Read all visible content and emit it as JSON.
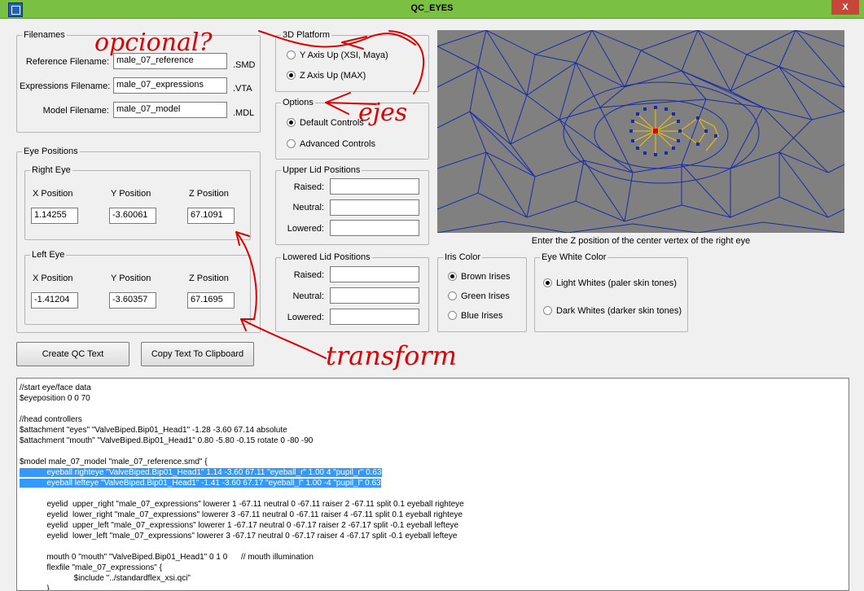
{
  "window": {
    "title": "QC_EYES",
    "close_label": "X"
  },
  "filenames": {
    "group_label": "Filenames",
    "reference": {
      "label": "Reference Filename:",
      "value": "male_07_reference",
      "ext": ".SMD"
    },
    "expressions": {
      "label": "Expressions Filename:",
      "value": "male_07_expressions",
      "ext": ".VTA"
    },
    "model": {
      "label": "Model Filename:",
      "value": "male_07_model",
      "ext": ".MDL"
    }
  },
  "platform": {
    "group_label": "3D Platform",
    "options": [
      {
        "label": "Y Axis Up (XSI, Maya)",
        "selected": false
      },
      {
        "label": "Z Axis Up (MAX)",
        "selected": true
      }
    ]
  },
  "options": {
    "group_label": "Options",
    "items": [
      {
        "label": "Default Controls",
        "selected": true
      },
      {
        "label": "Advanced Controls",
        "selected": false
      }
    ]
  },
  "eye_positions": {
    "group_label": "Eye Positions",
    "right": {
      "label": "Right Eye",
      "x_label": "X Position",
      "y_label": "Y Position",
      "z_label": "Z Position",
      "x": "1.14255",
      "y": "-3.60061",
      "z": "67.1091"
    },
    "left": {
      "label": "Left Eye",
      "x_label": "X Position",
      "y_label": "Y Position",
      "z_label": "Z Position",
      "x": "-1.41204",
      "y": "-3.60357",
      "z": "67.1695"
    }
  },
  "upper_lid": {
    "group_label": "Upper Lid Positions",
    "raised": "Raised:",
    "neutral": "Neutral:",
    "lowered": "Lowered:"
  },
  "lowered_lid": {
    "group_label": "Lowered Lid Positions",
    "raised": "Raised:",
    "neutral": "Neutral:",
    "lowered": "Lowered:"
  },
  "iris": {
    "group_label": "Iris Color",
    "items": [
      {
        "label": "Brown Irises",
        "selected": true
      },
      {
        "label": "Green Irises",
        "selected": false
      },
      {
        "label": "Blue Irises",
        "selected": false
      }
    ]
  },
  "eye_white": {
    "group_label": "Eye White Color",
    "items": [
      {
        "label": "Light Whites (paler skin tones)",
        "selected": true
      },
      {
        "label": "Dark Whites (darker skin tones)",
        "selected": false
      }
    ]
  },
  "viewport_caption": "Enter the Z position of the center vertex of the right eye",
  "buttons": {
    "create": "Create QC Text",
    "copy": "Copy Text To Clipboard"
  },
  "output_lines": [
    "//start eye/face data",
    "$eyeposition 0 0 70",
    "",
    "//head controllers",
    "$attachment \"eyes\" \"ValveBiped.Bip01_Head1\" -1.28 -3.60 67.14 absolute",
    "$attachment \"mouth\" \"ValveBiped.Bip01_Head1\" 0.80 -5.80 -0.15 rotate 0 -80 -90",
    "",
    "$model male_07_model \"male_07_reference.smd\" {",
    "            eyeball righteye \"ValveBiped.Bip01_Head1\" 1.14 -3.60 67.11 \"eyeball_r\" 1.00 4 \"pupil_r\" 0.63",
    "            eyeball lefteye \"ValveBiped.Bip01_Head1\" -1.41 -3.60 67.17 \"eyeball_l\" 1.00 -4 \"pupil_l\" 0.63",
    "",
    "            eyelid  upper_right \"male_07_expressions\" lowerer 1 -67.11 neutral 0 -67.11 raiser 2 -67.11 split 0.1 eyeball righteye",
    "            eyelid  lower_right \"male_07_expressions\" lowerer 3 -67.11 neutral 0 -67.11 raiser 4 -67.11 split 0.1 eyeball righteye",
    "            eyelid  upper_left \"male_07_expressions\" lowerer 1 -67.17 neutral 0 -67.17 raiser 2 -67.17 split -0.1 eyeball lefteye",
    "            eyelid  lower_left \"male_07_expressions\" lowerer 3 -67.17 neutral 0 -67.17 raiser 4 -67.17 split -0.1 eyeball lefteye",
    "",
    "            mouth 0 \"mouth\" \"ValveBiped.Bip01_Head1\" 0 1 0      // mouth illumination",
    "            flexfile \"male_07_expressions\" {",
    "                        $include \"../standardflex_xsi.qci\"",
    "            }"
  ],
  "highlighted_lines": [
    8,
    9
  ],
  "annotations": [
    "opcional?",
    "ejes",
    "transform"
  ]
}
